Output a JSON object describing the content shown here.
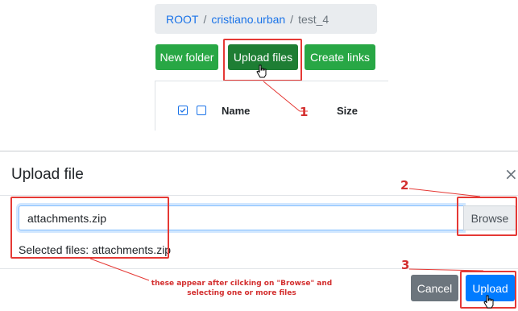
{
  "breadcrumb": {
    "root": "ROOT",
    "sep1": "/",
    "user": "cristiano.urban",
    "sep2": "/",
    "folder": "test_4"
  },
  "toolbar": {
    "new_folder": "New folder",
    "upload_files": "Upload files",
    "create_links": "Create links"
  },
  "table": {
    "headers": {
      "name": "Name",
      "size": "Size"
    }
  },
  "modal": {
    "title": "Upload file",
    "close": "×",
    "file_value": "attachments.zip",
    "browse_label": "Browse",
    "selected_text": "Selected files: attachments.zip",
    "cancel_label": "Cancel",
    "upload_label": "Upload"
  },
  "annotations": {
    "step1": "1",
    "step2": "2",
    "step3": "3",
    "note_line1": "these appear after cilcking on \"Browse\" and",
    "note_line2": "selecting one or more files",
    "color": "#e53935"
  },
  "colors": {
    "green": "#28a745",
    "dark_green": "#1e7e34",
    "primary": "#007bff",
    "secondary": "#6c757d"
  }
}
